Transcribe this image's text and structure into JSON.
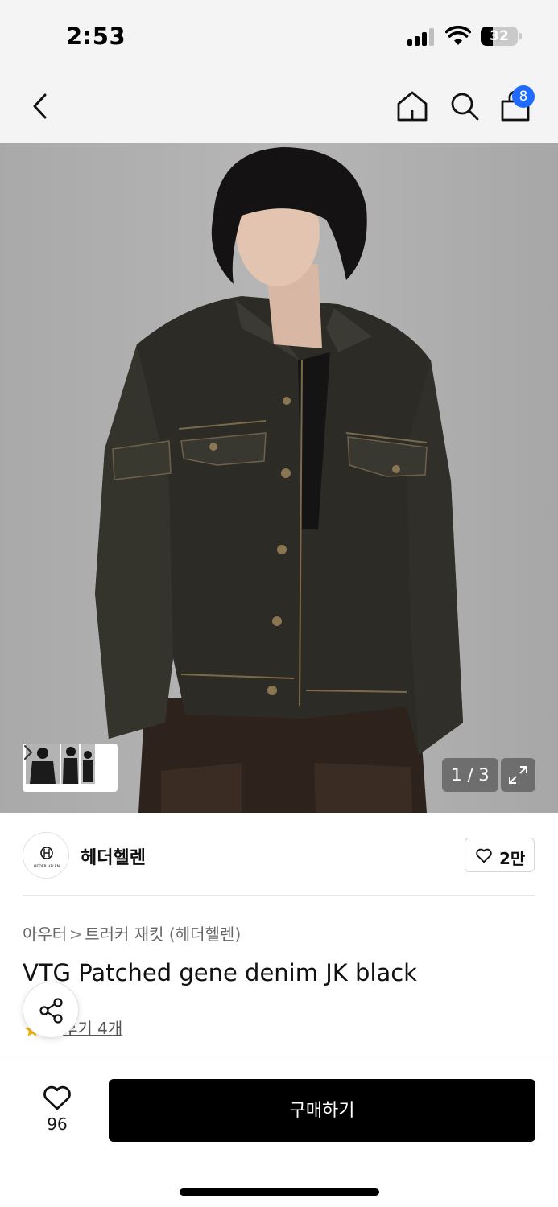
{
  "status_bar": {
    "time": "2:53",
    "battery": "32",
    "battery_level": 0.32
  },
  "nav": {
    "back_icon": "chevron-left-icon",
    "home_icon": "home-icon",
    "search_icon": "search-icon",
    "cart_icon": "shopping-bag-icon",
    "cart_count": "8",
    "badge_color": "#1f6bff"
  },
  "gallery": {
    "counter": "1 / 3",
    "expand_icon": "expand-icon",
    "thumbnail_arrow_icon": "chevron-right-icon"
  },
  "brand": {
    "name": "헤더헬렌",
    "logo_text": "HEDER HELEN",
    "like_count": "2만",
    "like_icon": "heart-outline-icon"
  },
  "product": {
    "breadcrumb": [
      "아우터",
      "트러커 재킷 (헤더헬렌)"
    ],
    "breadcrumb_separator": ">",
    "title": "VTG Patched gene denim JK black",
    "reviews_label": "후기 4개",
    "star_color": "#f5b400",
    "share_icon": "share-icon"
  },
  "bottom_bar": {
    "wish_icon": "heart-outline-icon",
    "wish_count": "96",
    "buy_label": "구매하기",
    "buy_color": "#000000"
  }
}
